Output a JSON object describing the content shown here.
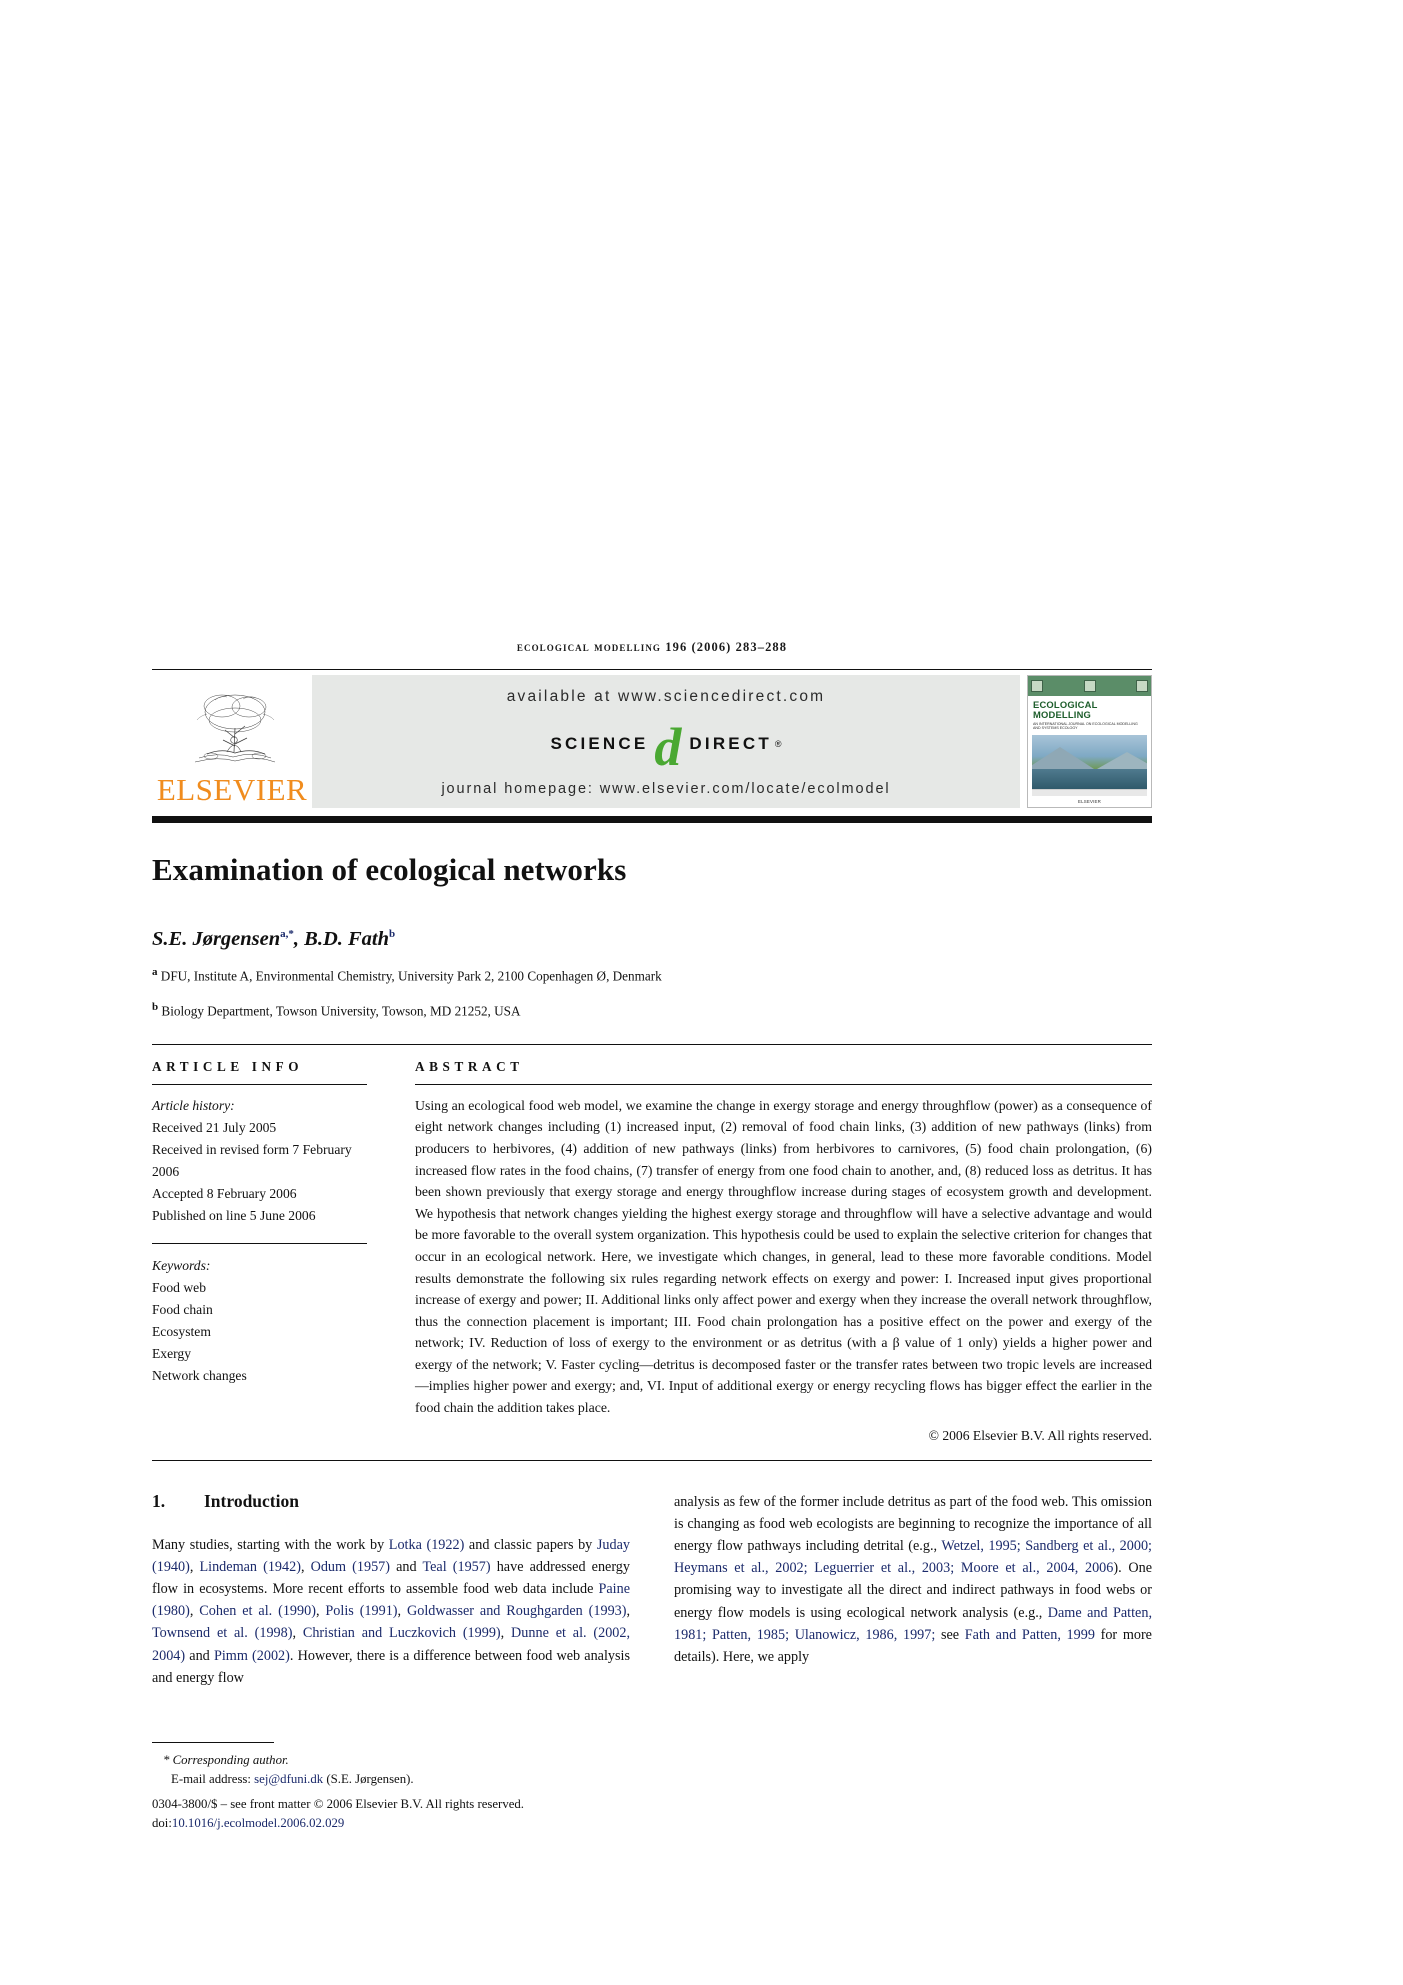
{
  "running_head": "ECOLOGICAL MODELLING 196 (2006) 283–288",
  "masthead": {
    "publisher": "ELSEVIER",
    "available_at": "available at www.sciencedirect.com",
    "sd_science": "SCIENCE",
    "sd_d": "d",
    "sd_direct": "DIRECT",
    "sd_reg": "®",
    "journal_homepage": "journal homepage: www.elsevier.com/locate/ecolmodel",
    "cover": {
      "title": "ECOLOGICAL MODELLING",
      "subtitle": "AN INTERNATIONAL JOURNAL ON ECOLOGICAL MODELLING AND SYSTEMS ECOLOGY",
      "footer": "ELSEVIER"
    }
  },
  "article": {
    "title": "Examination of ecological networks",
    "authors_html": "S.E. Jørgensen<sup>a,</sup><sup>*</sup>, B.D. Fath<sup>b</sup>",
    "affiliation_a": "DFU, Institute A, Environmental Chemistry, University Park 2, 2100 Copenhagen Ø, Denmark",
    "affiliation_b": "Biology Department, Towson University, Towson, MD 21252, USA"
  },
  "article_info": {
    "heading": "ARTICLE INFO",
    "history_label": "Article history:",
    "history": [
      "Received 21 July 2005",
      "Received in revised form 7 February",
      "2006",
      "Accepted 8 February 2006",
      "Published on line 5 June 2006"
    ],
    "keywords_label": "Keywords:",
    "keywords": [
      "Food web",
      "Food chain",
      "Ecosystem",
      "Exergy",
      "Network changes"
    ]
  },
  "abstract": {
    "heading": "ABSTRACT",
    "text": "Using an ecological food web model, we examine the change in exergy storage and energy throughflow (power) as a consequence of eight network changes including (1) increased input, (2) removal of food chain links, (3) addition of new pathways (links) from producers to herbivores, (4) addition of new pathways (links) from herbivores to carnivores, (5) food chain prolongation, (6) increased flow rates in the food chains, (7) transfer of energy from one food chain to another, and, (8) reduced loss as detritus. It has been shown previously that exergy storage and energy throughflow increase during stages of ecosystem growth and development. We hypothesis that network changes yielding the highest exergy storage and throughflow will have a selective advantage and would be more favorable to the overall system organization. This hypothesis could be used to explain the selective criterion for changes that occur in an ecological network. Here, we investigate which changes, in general, lead to these more favorable conditions. Model results demonstrate the following six rules regarding network effects on exergy and power: I. Increased input gives proportional increase of exergy and power; II. Additional links only affect power and exergy when they increase the overall network throughflow, thus the connection placement is important; III. Food chain prolongation has a positive effect on the power and exergy of the network; IV. Reduction of loss of exergy to the environment or as detritus (with a β value of 1 only) yields a higher power and exergy of the network; V. Faster cycling—detritus is decomposed faster or the transfer rates between two tropic levels are increased—implies higher power and exergy; and, VI. Input of additional exergy or energy recycling flows has bigger effect the earlier in the food chain the addition takes place.",
    "copyright": "© 2006 Elsevier B.V. All rights reserved."
  },
  "introduction": {
    "number": "1.",
    "title": "Introduction",
    "col_left_html": "Many studies, starting with the work by <span class=\"cite\">Lotka (1922)</span> and classic papers by <span class=\"cite\">Juday (1940)</span>, <span class=\"cite\">Lindeman (1942)</span>, <span class=\"cite\">Odum (1957)</span> and <span class=\"cite\">Teal (1957)</span> have addressed energy flow in ecosystems. More recent efforts to assemble food web data include <span class=\"cite\">Paine (1980)</span>, <span class=\"cite\">Cohen et al. (1990)</span>, <span class=\"cite\">Polis (1991)</span>, <span class=\"cite\">Goldwasser and Roughgarden (1993)</span>, <span class=\"cite\">Townsend et al. (1998)</span>, <span class=\"cite\">Christian and Luczkovich (1999)</span>, <span class=\"cite\">Dunne et al. (2002, 2004)</span> and <span class=\"cite\">Pimm (2002)</span>. However, there is a difference between food web analysis and energy flow",
    "col_right_html": "analysis as few of the former include detritus as part of the food web. This omission is changing as food web ecologists are beginning to recognize the importance of all energy flow pathways including detrital (e.g., <span class=\"cite\">Wetzel, 1995; Sandberg et al., 2000; Heymans et al., 2002; Leguerrier et al., 2003; Moore et al., 2004, 2006</span>). One promising way to investigate all the direct and indirect pathways in food webs or energy flow models is using ecological network analysis (e.g., <span class=\"cite\">Dame and Patten, 1981; Patten, 1985; Ulanowicz, 1986, 1997;</span> see <span class=\"cite\">Fath and Patten, 1999</span> for more details). Here, we apply"
  },
  "footnote": {
    "corresponding": "* Corresponding author.",
    "email_label": "E-mail address:",
    "email": "sej@dfuni.dk",
    "email_tail": "(S.E. Jørgensen).",
    "issn_line": "0304-3800/$ – see front matter © 2006 Elsevier B.V. All rights reserved.",
    "doi_label": "doi:",
    "doi": "10.1016/j.ecolmodel.2006.02.029"
  },
  "colors": {
    "elsevier_orange": "#F08C1E",
    "sciencedirect_green": "#4aa832",
    "citation_blue": "#1b2a6b",
    "banner_gray": "#e6e8e6"
  }
}
